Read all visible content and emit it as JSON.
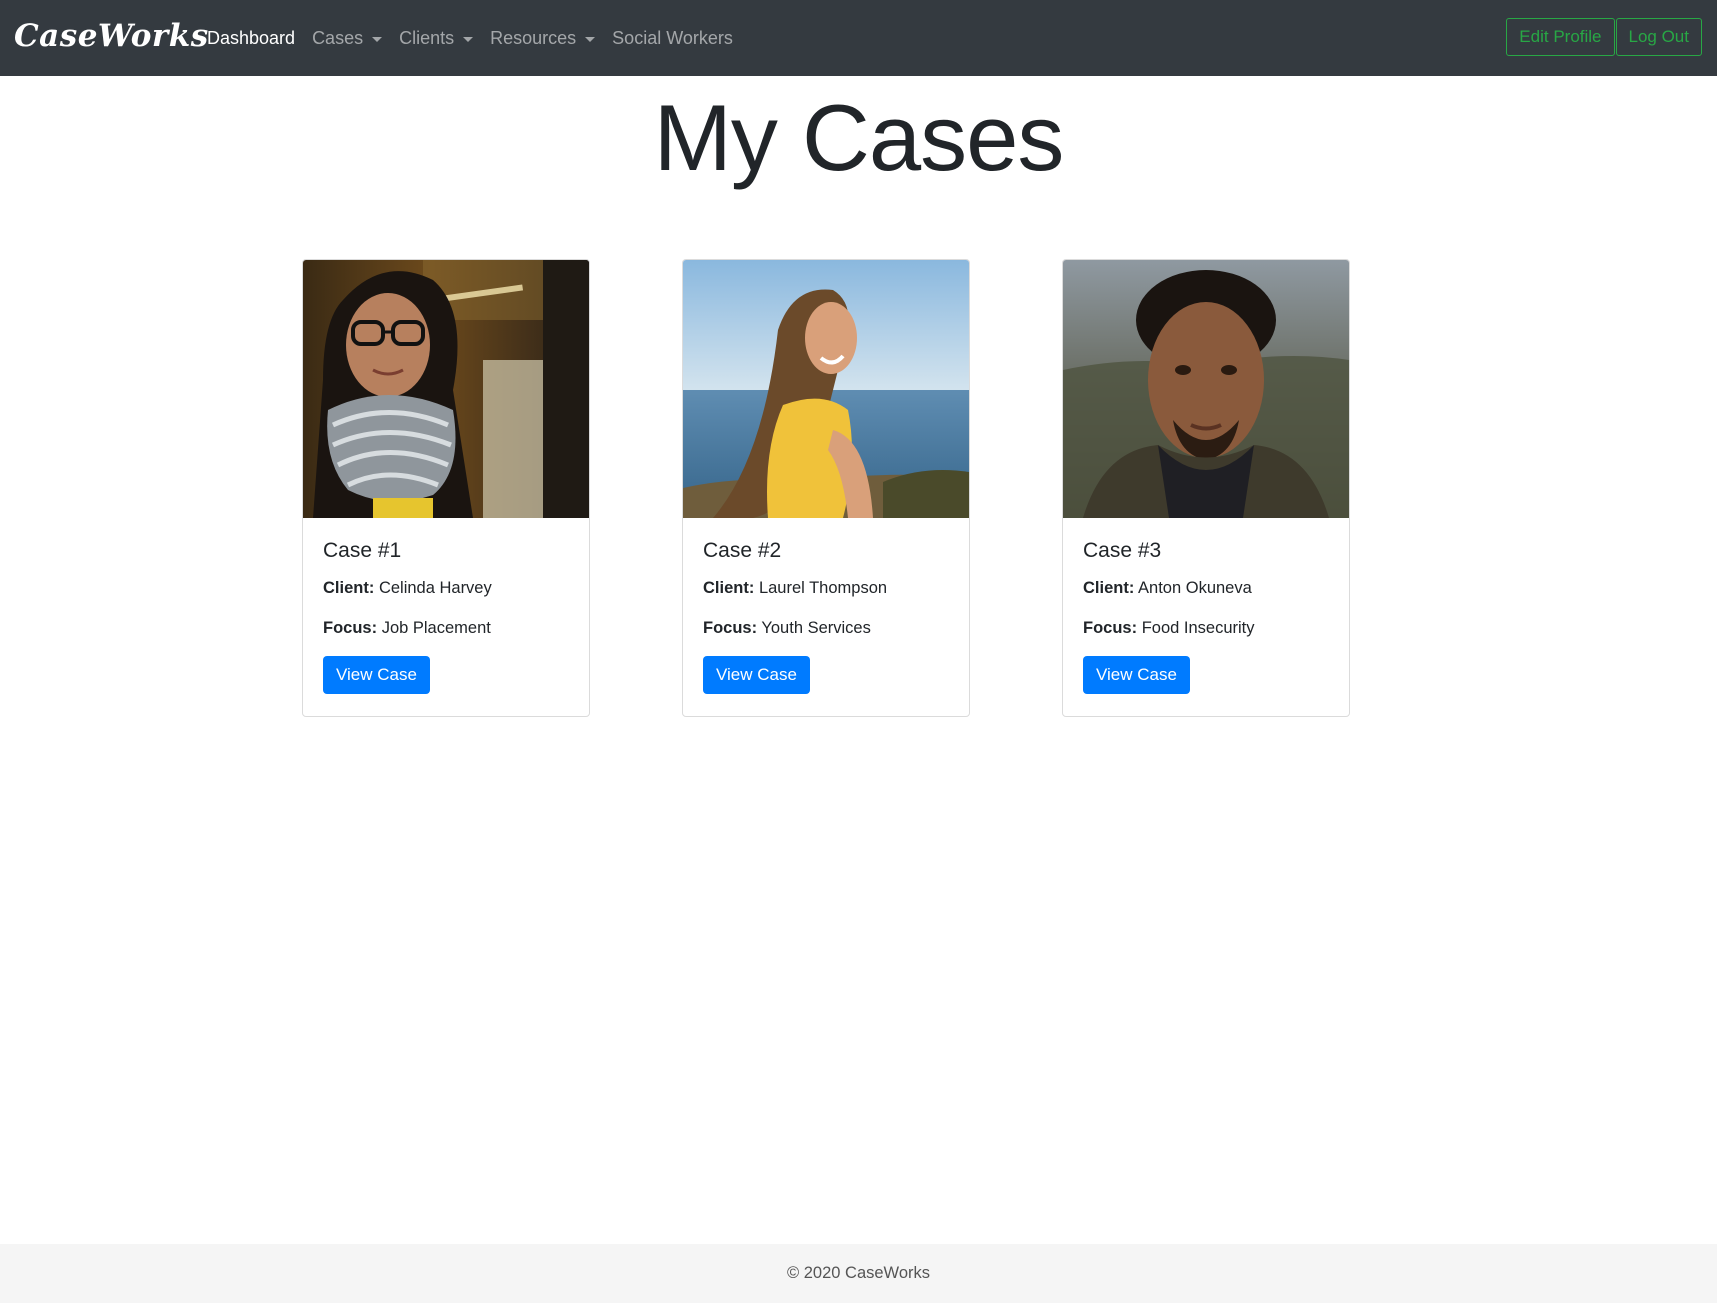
{
  "navbar": {
    "brand": "CaseWorks",
    "links": [
      {
        "label": "Dashboard",
        "active": true,
        "dropdown": false
      },
      {
        "label": "Cases",
        "active": false,
        "dropdown": true
      },
      {
        "label": "Clients",
        "active": false,
        "dropdown": true
      },
      {
        "label": "Resources",
        "active": false,
        "dropdown": true
      },
      {
        "label": "Social Workers",
        "active": false,
        "dropdown": false
      }
    ],
    "edit_profile": "Edit Profile",
    "log_out": "Log Out"
  },
  "page": {
    "title": "My Cases"
  },
  "labels": {
    "client": "Client:",
    "focus": "Focus:"
  },
  "cases": [
    {
      "title": "Case #1",
      "client": "Celinda Harvey",
      "focus": "Job Placement",
      "button": "View Case"
    },
    {
      "title": "Case #2",
      "client": "Laurel Thompson",
      "focus": "Youth Services",
      "button": "View Case"
    },
    {
      "title": "Case #3",
      "client": "Anton Okuneva",
      "focus": "Food Insecurity",
      "button": "View Case"
    }
  ],
  "footer": {
    "text": "© 2020 CaseWorks"
  },
  "colors": {
    "navbar_bg": "#343a40",
    "primary": "#007bff",
    "success": "#28a745",
    "footer_bg": "#f5f5f5"
  }
}
